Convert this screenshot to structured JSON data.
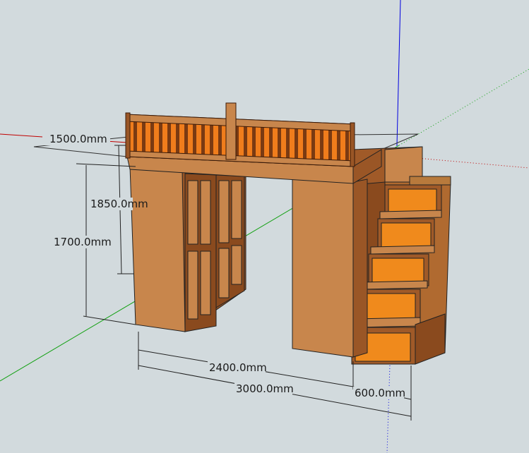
{
  "dimensions": {
    "depth_top": "1500.0mm",
    "height_top": "1850.0mm",
    "height_under": "1700.0mm",
    "span_inner": "2400.0mm",
    "span_total": "3000.0mm",
    "stair_width": "600.0mm"
  },
  "colors": {
    "background": "#d2dadd",
    "wood_front": "#c8864c",
    "wood_dark": "#8a4a1e",
    "drawer_orange": "#f08a1c",
    "axis_red": "#c00000",
    "axis_green": "#10a010",
    "axis_blue": "#0000e0"
  }
}
